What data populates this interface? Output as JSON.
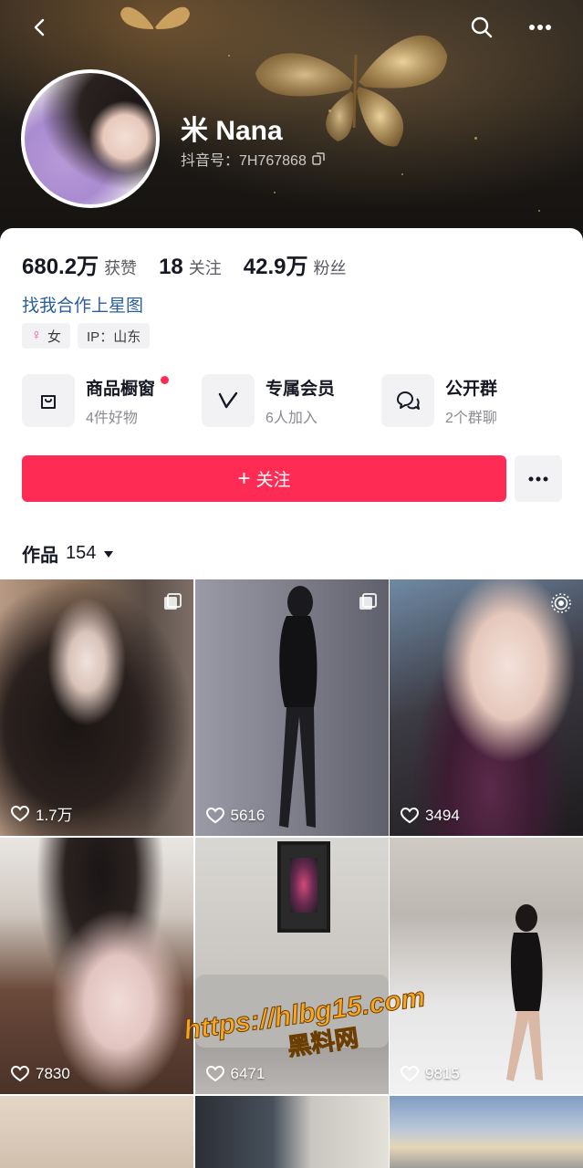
{
  "profile": {
    "nickname": "米 Nana",
    "douyin_id_label": "抖音号：7H767868",
    "stats": [
      {
        "value": "680.2万",
        "label": "获赞"
      },
      {
        "value": "18",
        "label": "关注"
      },
      {
        "value": "42.9万",
        "label": "粉丝"
      }
    ],
    "collab_link": "找我合作上星图",
    "tags": {
      "gender": "女",
      "ip": "IP：山东"
    }
  },
  "services": [
    {
      "title": "商品橱窗",
      "subtitle": "4件好物",
      "icon": "shopping-bag-icon",
      "has_dot": true
    },
    {
      "title": "专属会员",
      "subtitle": "6人加入",
      "icon": "vip-v-icon",
      "has_dot": false
    },
    {
      "title": "公开群",
      "subtitle": "2个群聊",
      "icon": "group-chat-icon",
      "has_dot": false
    }
  ],
  "actions": {
    "follow_label": "关注",
    "follow_prefix": "+"
  },
  "works": {
    "label": "作品",
    "count": "154"
  },
  "grid": [
    {
      "likes": "1.7万",
      "badge": "gallery-icon"
    },
    {
      "likes": "5616",
      "badge": "gallery-icon"
    },
    {
      "likes": "3494",
      "badge": "live-photo-icon"
    },
    {
      "likes": "7830",
      "badge": ""
    },
    {
      "likes": "6471",
      "badge": ""
    },
    {
      "likes": "9815",
      "badge": ""
    }
  ],
  "watermark": {
    "url": "https://hlbg15.com",
    "cn": "黑料网"
  },
  "colors": {
    "accent": "#fe2c55",
    "link": "#2b5e9c",
    "female": "#e95aa8",
    "watermark": "#f6a623"
  }
}
